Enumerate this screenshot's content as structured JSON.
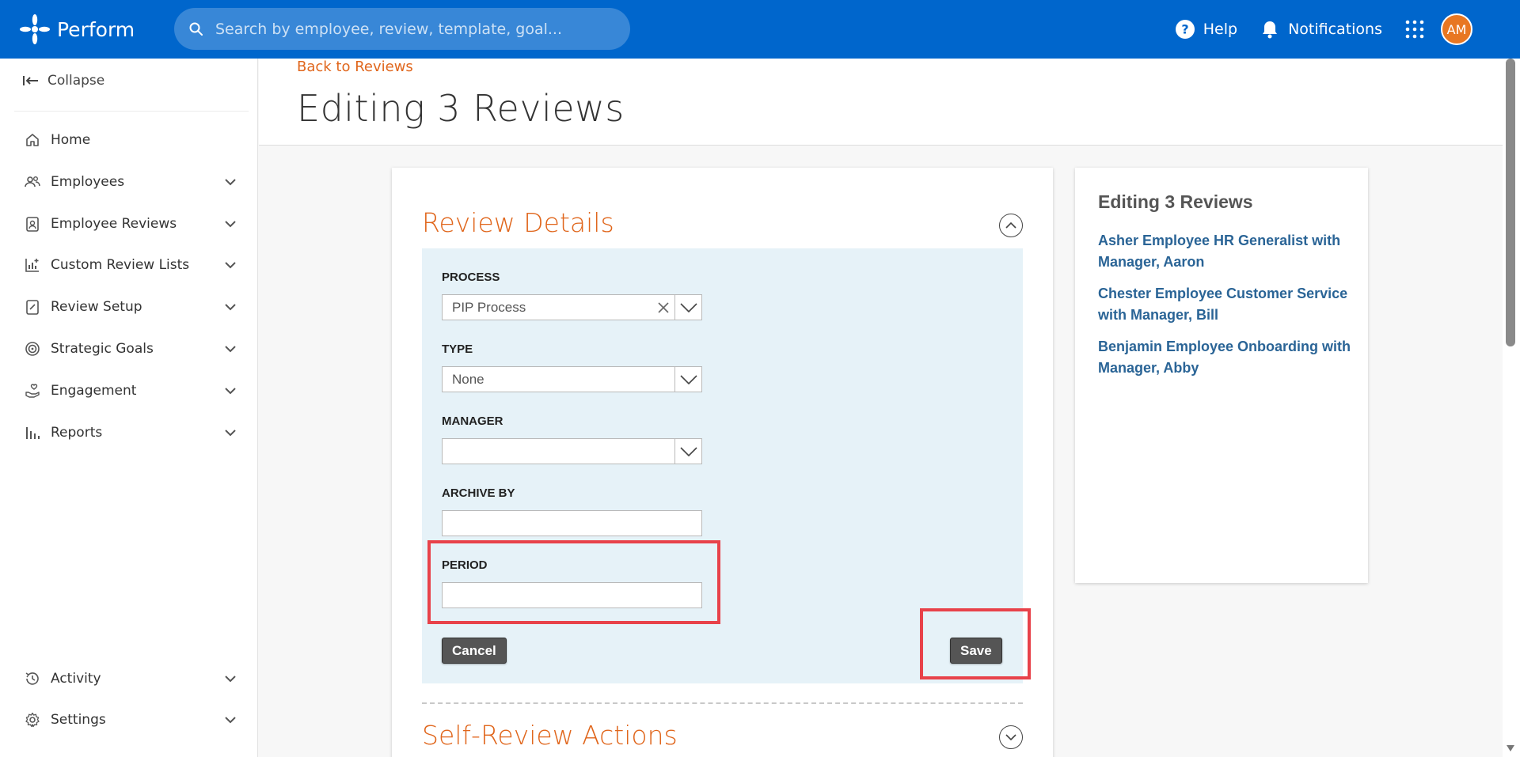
{
  "app": {
    "brand_name": "Perform",
    "search_placeholder": "Search by employee, review, template, goal...",
    "help_label": "Help",
    "notifications_label": "Notifications",
    "avatar_initials": "AM",
    "accent_color": "#0066cc",
    "avatar_color": "#e87722"
  },
  "sidebar": {
    "collapse_label": "Collapse",
    "items": [
      {
        "label": "Home",
        "icon": "home-icon",
        "expandable": false
      },
      {
        "label": "Employees",
        "icon": "people-icon",
        "expandable": true
      },
      {
        "label": "Employee Reviews",
        "icon": "clipboard-user-icon",
        "expandable": true
      },
      {
        "label": "Custom Review Lists",
        "icon": "chart-plus-icon",
        "expandable": true
      },
      {
        "label": "Review Setup",
        "icon": "clipboard-check-icon",
        "expandable": true
      },
      {
        "label": "Strategic Goals",
        "icon": "target-icon",
        "expandable": true
      },
      {
        "label": "Engagement",
        "icon": "hand-heart-icon",
        "expandable": true
      },
      {
        "label": "Reports",
        "icon": "bar-chart-icon",
        "expandable": true
      }
    ],
    "bottom_items": [
      {
        "label": "Activity",
        "icon": "history-icon",
        "expandable": true
      },
      {
        "label": "Settings",
        "icon": "gear-icon",
        "expandable": true
      }
    ]
  },
  "header": {
    "back_link": "Back to Reviews",
    "title": "Editing 3 Reviews"
  },
  "review_details": {
    "section_title": "Review Details",
    "process_label": "PROCESS",
    "process_value": "PIP Process",
    "type_label": "TYPE",
    "type_value": "None",
    "manager_label": "MANAGER",
    "manager_value": "",
    "archive_by_label": "ARCHIVE BY",
    "archive_by_value": "",
    "period_label": "PERIOD",
    "period_value": "",
    "cancel_label": "Cancel",
    "save_label": "Save"
  },
  "self_review": {
    "section_title": "Self-Review Actions"
  },
  "side_panel": {
    "title": "Editing 3 Reviews",
    "reviews": [
      "Asher Employee HR Generalist with Manager, Aaron",
      "Chester Employee Customer Service with Manager, Bill",
      "Benjamin Employee Onboarding with Manager, Abby"
    ]
  },
  "annotations": {
    "highlight_color": "#e8424a"
  }
}
